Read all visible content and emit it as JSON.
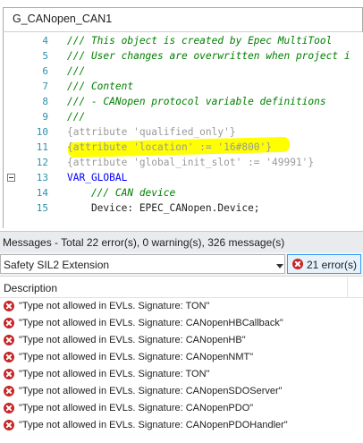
{
  "editor": {
    "title": "G_CANopen_CAN1",
    "lines": [
      {
        "num": "4",
        "text": "/// This object is created by Epec MultiTool",
        "kind": "comment"
      },
      {
        "num": "5",
        "text": "/// User changes are overwritten when project i",
        "kind": "comment"
      },
      {
        "num": "6",
        "text": "///",
        "kind": "comment"
      },
      {
        "num": "7",
        "text": "/// Content",
        "kind": "comment"
      },
      {
        "num": "8",
        "text": "/// - CANopen protocol variable definitions",
        "kind": "comment"
      },
      {
        "num": "9",
        "text": "///",
        "kind": "comment"
      },
      {
        "num": "10",
        "text": "{attribute 'qualified_only'}",
        "kind": "attr"
      },
      {
        "num": "11",
        "text": "{attribute 'location' := '16#800'}",
        "kind": "attr"
      },
      {
        "num": "12",
        "text": "{attribute 'global_init_slot' := '49991'}",
        "kind": "attr"
      },
      {
        "num": "13",
        "text": "VAR_GLOBAL",
        "kind": "kw"
      },
      {
        "num": "14",
        "text": "    /// CAN device",
        "kind": "comment"
      },
      {
        "num": "15",
        "text": "    Device: EPEC_CANopen.Device;",
        "kind": "id"
      }
    ]
  },
  "messages": {
    "header": "Messages - Total 22 error(s), 0 warning(s), 326 message(s)",
    "source": "Safety SIL2 Extension",
    "errors_label": "21 error(s)",
    "column_description": "Description",
    "rows": [
      "\"Type not allowed in EVLs. Signature: TON\"",
      "\"Type not allowed in EVLs. Signature: CANopenHBCallback\"",
      "\"Type not allowed in EVLs. Signature: CANopenHB\"",
      "\"Type not allowed in EVLs. Signature: CANopenNMT\"",
      "\"Type not allowed in EVLs. Signature: TON\"",
      "\"Type not allowed in EVLs. Signature: CANopenSDOServer\"",
      "\"Type not allowed in EVLs. Signature: CANopenPDO\"",
      "\"Type not allowed in EVLs. Signature: CANopenPDOHandler\""
    ]
  },
  "icons": {
    "error": "error-circle-icon",
    "dropdown": "chevron-down-icon",
    "fold": "collapse-minus-icon"
  },
  "colors": {
    "comment": "#008000",
    "keyword": "#0000ff",
    "line_number": "#2b91af",
    "highlight": "#ffff00",
    "error": "#c62828"
  }
}
